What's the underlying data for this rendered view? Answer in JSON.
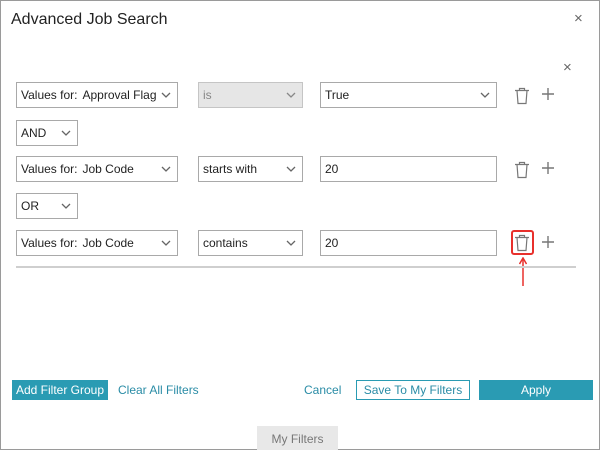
{
  "dialog": {
    "title": "Advanced Job Search",
    "close_glyph": "×"
  },
  "filter_group": {
    "close_glyph": "×",
    "rows": [
      {
        "field_prefix": "Values for:",
        "field": "Approval Flag",
        "operator": "is",
        "operator_disabled": true,
        "value": "True",
        "value_type": "select"
      },
      {
        "field_prefix": "Values for:",
        "field": "Job Code",
        "operator": "starts with",
        "operator_disabled": false,
        "value": "20",
        "value_type": "text"
      },
      {
        "field_prefix": "Values for:",
        "field": "Job Code",
        "operator": "contains",
        "operator_disabled": false,
        "value": "20",
        "value_type": "text"
      }
    ],
    "connectors": [
      "AND",
      "OR"
    ],
    "icons": {
      "delete": "trash-icon",
      "add": "plus-icon"
    },
    "highlighted_delete_row": 2
  },
  "footer": {
    "add_filter_group": "Add Filter Group",
    "clear_all_filters": "Clear All Filters",
    "cancel": "Cancel",
    "save_to_my_filters": "Save To My Filters",
    "apply": "Apply"
  },
  "tab": {
    "my_filters": "My Filters"
  },
  "colors": {
    "accent": "#2a9bb3",
    "highlight": "#e8302c",
    "disabled_bg": "#e6e6e6"
  }
}
